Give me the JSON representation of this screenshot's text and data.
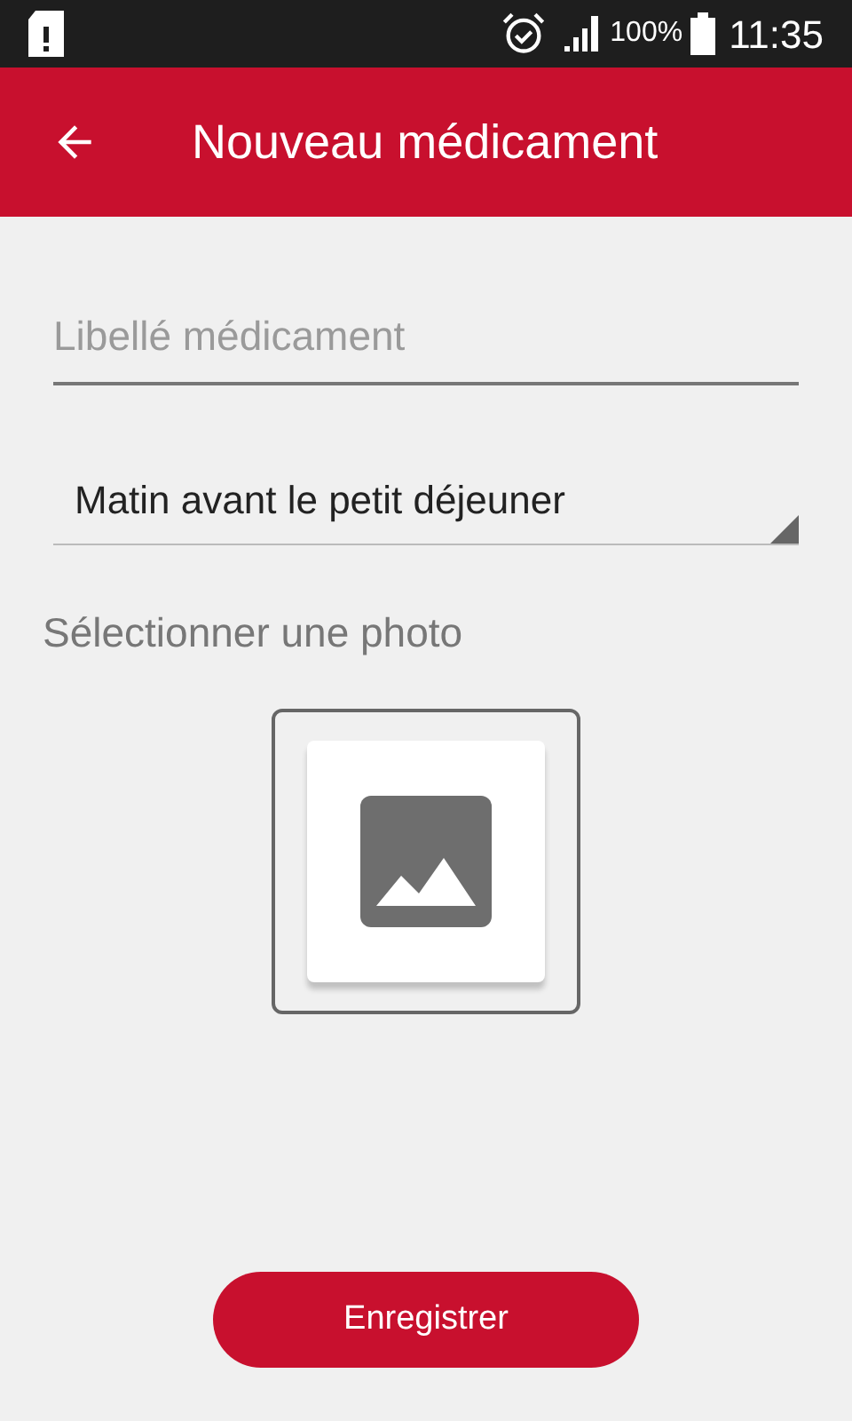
{
  "status_bar": {
    "battery": "100%",
    "time": "11:35"
  },
  "app_bar": {
    "title": "Nouveau médicament"
  },
  "name_field": {
    "placeholder": "Libellé médicament"
  },
  "moment_select": {
    "value": "Matin avant le petit déjeuner"
  },
  "photo": {
    "label": "Sélectionner une photo"
  },
  "save_button": {
    "label": "Enregistrer"
  }
}
